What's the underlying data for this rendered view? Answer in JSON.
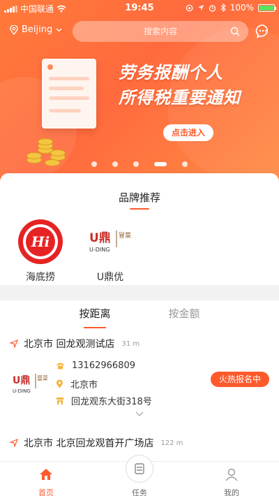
{
  "status_bar": {
    "carrier": "中国联通",
    "time": "19:45",
    "battery": "100%"
  },
  "header": {
    "city": "Beijing",
    "search_placeholder": "搜索内容"
  },
  "banner": {
    "title_line1": "劳务报酬个人",
    "title_line2": "所得税重要通知",
    "button_label": "点击进入",
    "slide_count": 5,
    "active_slide": 4
  },
  "brands": {
    "title": "品牌推荐",
    "items": [
      {
        "name": "海底捞",
        "logo_text": "Hi"
      },
      {
        "name": "U鼎优",
        "logo_text": "U鼎",
        "logo_sub": "冒菜",
        "logo_caption": "U-DING"
      }
    ]
  },
  "stores": {
    "tabs": [
      "按距离",
      "按金额"
    ],
    "active_tab": 0,
    "items": [
      {
        "name": "北京市 回龙观测试店",
        "distance": "31 m",
        "phone": "13162966809",
        "city": "北京市",
        "address": "回龙观东大街318号",
        "badge": "火热报名中"
      },
      {
        "name": "北京市 北京回龙观首开广场店",
        "distance": "122 m"
      }
    ]
  },
  "bottom_nav": {
    "items": [
      "首页",
      "任务",
      "我的"
    ],
    "active": 0
  },
  "colors": {
    "accent": "#ff5a2c",
    "banner_start": "#ff7a3a",
    "banner_end": "#ff8c45"
  }
}
